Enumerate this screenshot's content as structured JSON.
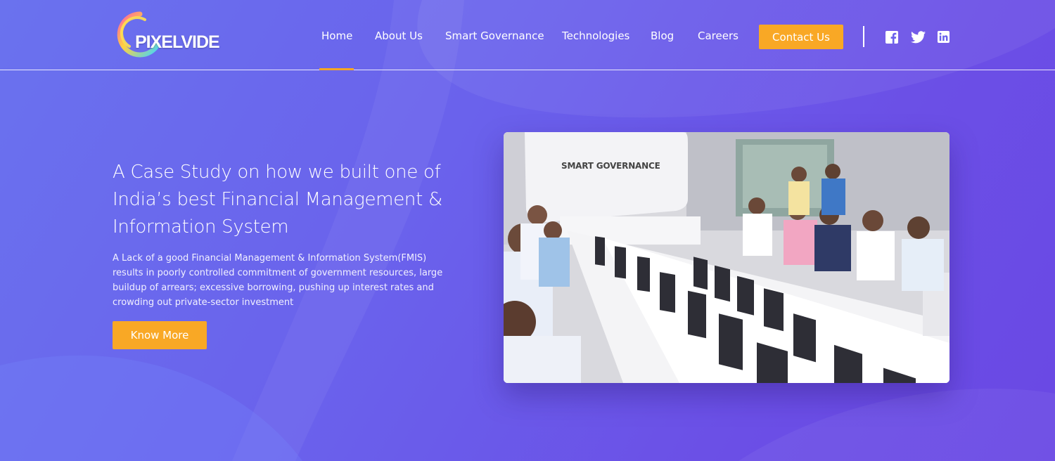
{
  "brand": {
    "name": "PIXELVIDE"
  },
  "nav": {
    "items": [
      {
        "label": "Home",
        "active": true
      },
      {
        "label": "About Us"
      },
      {
        "label": "Smart Governance"
      },
      {
        "label": "Technologies"
      },
      {
        "label": "Blog"
      },
      {
        "label": "Careers"
      }
    ],
    "contact_label": "Contact Us",
    "social": [
      "facebook-icon",
      "twitter-icon",
      "linkedin-icon"
    ]
  },
  "hero": {
    "title": "A Case Study on how we built one of India’s best Financial Management & Information System",
    "description": "A Lack of a good Financial Management & Information System(FMIS) results in poorly controlled commitment of government resources, large buildup of arrears; excessive borrowing, pushing up interest rates and crowding out private-sector investment",
    "button_label": "Know More",
    "image": {
      "sign_text": "SMART GOVERNANCE"
    }
  },
  "colors": {
    "accent": "#f9a825",
    "background": "#6a5ceb",
    "text": "#ffffff"
  }
}
